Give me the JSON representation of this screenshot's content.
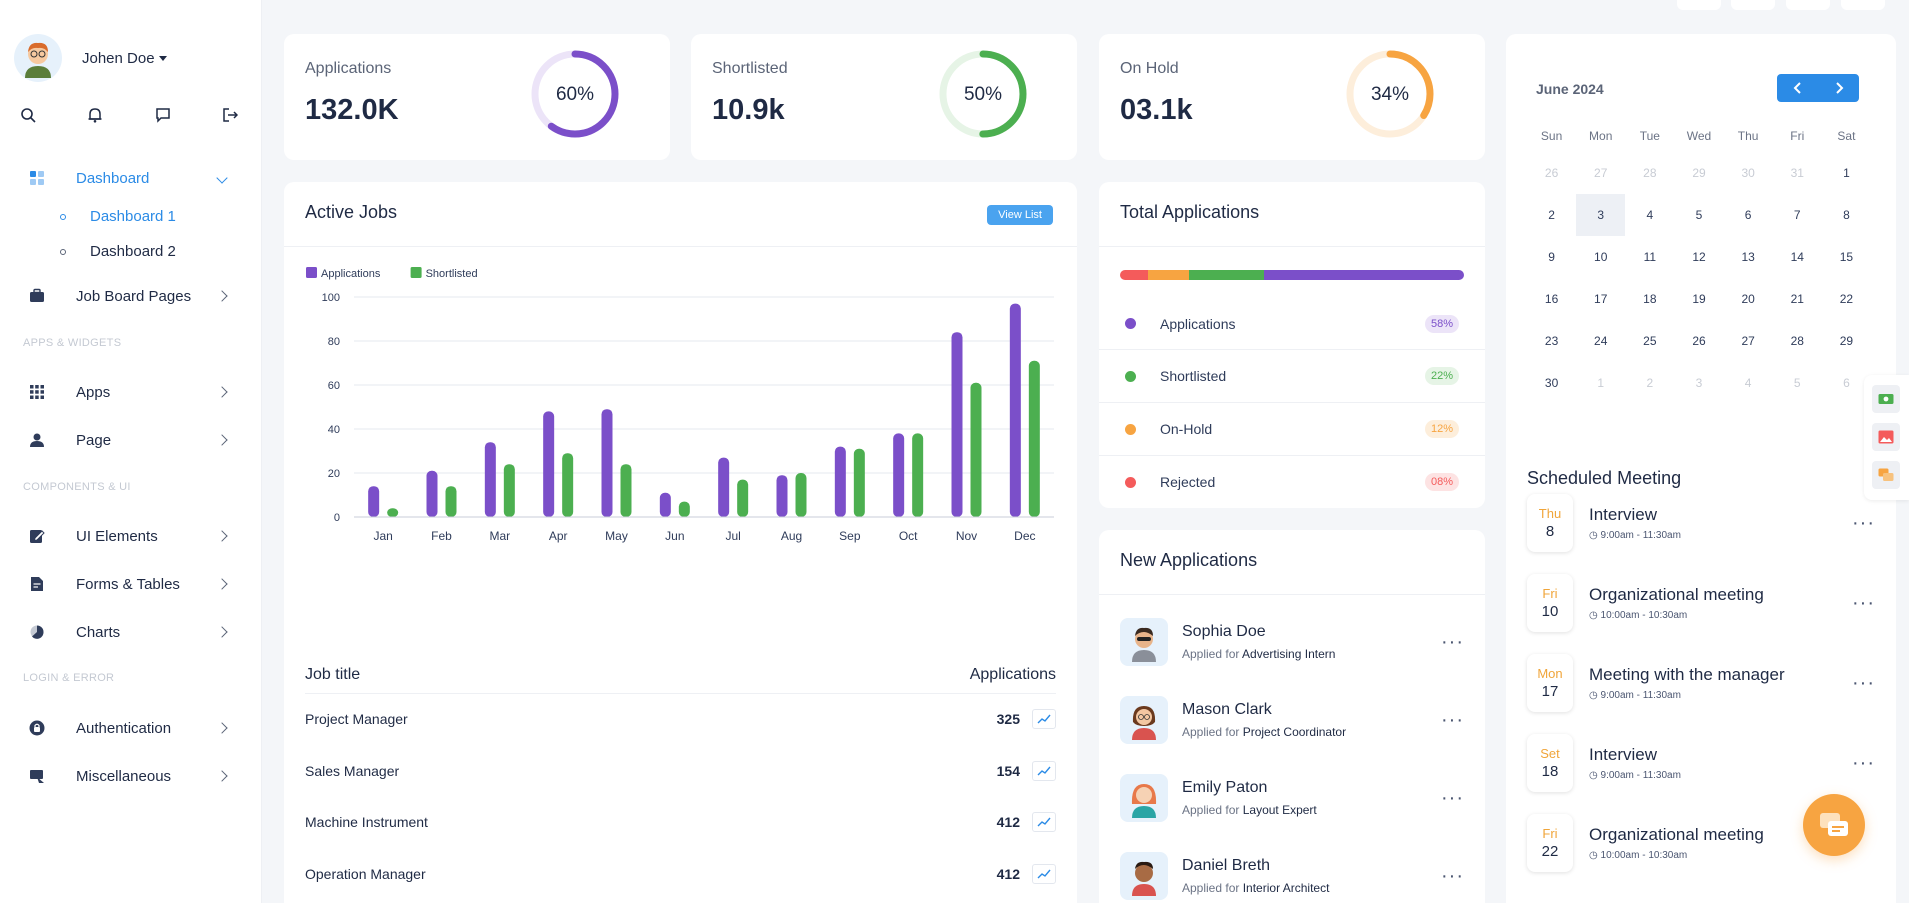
{
  "user": {
    "name": "Johen Doe"
  },
  "nav": {
    "dashboard": "Dashboard",
    "dashboard_sub": [
      "Dashboard 1",
      "Dashboard 2"
    ],
    "job_board": "Job Board Pages",
    "section_apps": "APPS & WIDGETS",
    "apps": "Apps",
    "page": "Page",
    "section_components": "COMPONENTS & UI",
    "ui_elements": "UI Elements",
    "forms_tables": "Forms & Tables",
    "charts": "Charts",
    "section_login": "LOGIN & ERROR",
    "authentication": "Authentication",
    "miscellaneous": "Miscellaneous"
  },
  "stats": [
    {
      "title": "Applications",
      "value": "132.0K",
      "percent": 60,
      "percent_label": "60%",
      "color": "#7b4fc9",
      "track": "#ece4f8"
    },
    {
      "title": "Shortlisted",
      "value": "10.9k",
      "percent": 50,
      "percent_label": "50%",
      "color": "#4caf50",
      "track": "#e6f4e6"
    },
    {
      "title": "On Hold",
      "value": "03.1k",
      "percent": 34,
      "percent_label": "34%",
      "color": "#f7a441",
      "track": "#fdeedb"
    }
  ],
  "active_jobs": {
    "title": "Active Jobs",
    "view_list": "View List",
    "table_header": {
      "job": "Job title",
      "applications": "Applications"
    },
    "rows": [
      {
        "job": "Project Manager",
        "count": "325"
      },
      {
        "job": "Sales Manager",
        "count": "154"
      },
      {
        "job": "Machine Instrument",
        "count": "412"
      },
      {
        "job": "Operation Manager",
        "count": "412"
      }
    ]
  },
  "chart_data": {
    "type": "bar",
    "categories": [
      "Jan",
      "Feb",
      "Mar",
      "Apr",
      "May",
      "Jun",
      "Jul",
      "Aug",
      "Sep",
      "Oct",
      "Nov",
      "Dec"
    ],
    "series": [
      {
        "name": "Applications",
        "color": "#7b4fc9",
        "values": [
          14,
          21,
          34,
          48,
          49,
          11,
          27,
          19,
          32,
          38,
          84,
          97
        ]
      },
      {
        "name": "Shortlisted",
        "color": "#4caf50",
        "values": [
          4,
          14,
          24,
          29,
          24,
          7,
          17,
          20,
          31,
          38,
          61,
          71
        ]
      }
    ],
    "yticks": [
      "0",
      "20",
      "40",
      "60",
      "80",
      "100"
    ],
    "ylim": [
      0,
      100
    ],
    "grid": true,
    "legend": "top-left"
  },
  "total_applications": {
    "title": "Total Applications",
    "segments": [
      {
        "color": "#f45b5b",
        "share": 8
      },
      {
        "color": "#f7a441",
        "share": 12
      },
      {
        "color": "#4caf50",
        "share": 22
      },
      {
        "color": "#7b4fc9",
        "share": 58
      }
    ],
    "rows": [
      {
        "label": "Applications",
        "badge": "58%",
        "color": "#7b4fc9",
        "badge_bg": "#ece4f8",
        "badge_fg": "#7b4fc9"
      },
      {
        "label": "Shortlisted",
        "badge": "22%",
        "color": "#4caf50",
        "badge_bg": "#e6f4e6",
        "badge_fg": "#4caf50"
      },
      {
        "label": "On-Hold",
        "badge": "12%",
        "color": "#f7a441",
        "badge_bg": "#fdeedb",
        "badge_fg": "#f7a441"
      },
      {
        "label": "Rejected",
        "badge": "08%",
        "color": "#f45b5b",
        "badge_bg": "#fde3e3",
        "badge_fg": "#f45b5b"
      }
    ]
  },
  "new_applications": {
    "title": "New Applications",
    "applied_for": "Applied for",
    "items": [
      {
        "name": "Sophia Doe",
        "role": "Advertising Intern"
      },
      {
        "name": "Mason Clark",
        "role": "Project Coordinator"
      },
      {
        "name": "Emily Paton",
        "role": "Layout Expert"
      },
      {
        "name": "Daniel Breth",
        "role": "Interior Architect"
      }
    ]
  },
  "calendar": {
    "month": "June 2024",
    "weekdays": [
      "Sun",
      "Mon",
      "Tue",
      "Wed",
      "Thu",
      "Fri",
      "Sat"
    ],
    "days": [
      {
        "d": "26",
        "muted": true
      },
      {
        "d": "27",
        "muted": true
      },
      {
        "d": "28",
        "muted": true
      },
      {
        "d": "29",
        "muted": true
      },
      {
        "d": "30",
        "muted": true
      },
      {
        "d": "31",
        "muted": true
      },
      {
        "d": "1"
      },
      {
        "d": "2"
      },
      {
        "d": "3",
        "selected": true
      },
      {
        "d": "4"
      },
      {
        "d": "5"
      },
      {
        "d": "6"
      },
      {
        "d": "7"
      },
      {
        "d": "8"
      },
      {
        "d": "9"
      },
      {
        "d": "10"
      },
      {
        "d": "11"
      },
      {
        "d": "12"
      },
      {
        "d": "13"
      },
      {
        "d": "14"
      },
      {
        "d": "15"
      },
      {
        "d": "16"
      },
      {
        "d": "17"
      },
      {
        "d": "18"
      },
      {
        "d": "19"
      },
      {
        "d": "20"
      },
      {
        "d": "21"
      },
      {
        "d": "22"
      },
      {
        "d": "23"
      },
      {
        "d": "24"
      },
      {
        "d": "25"
      },
      {
        "d": "26"
      },
      {
        "d": "27"
      },
      {
        "d": "28"
      },
      {
        "d": "29"
      },
      {
        "d": "30"
      },
      {
        "d": "1",
        "muted": true
      },
      {
        "d": "2",
        "muted": true
      },
      {
        "d": "3",
        "muted": true
      },
      {
        "d": "4",
        "muted": true
      },
      {
        "d": "5",
        "muted": true
      },
      {
        "d": "6",
        "muted": true
      }
    ]
  },
  "meetings": {
    "title": "Scheduled Meeting",
    "items": [
      {
        "day": "Thu",
        "date": "8",
        "title": "Interview",
        "time": "9:00am - 11:30am"
      },
      {
        "day": "Fri",
        "date": "10",
        "title": "Organizational meeting",
        "time": "10:00am - 10:30am"
      },
      {
        "day": "Mon",
        "date": "17",
        "title": "Meeting with the manager",
        "time": "9:00am - 11:30am"
      },
      {
        "day": "Set",
        "date": "18",
        "title": "Interview",
        "time": "9:00am - 11:30am"
      },
      {
        "day": "Fri",
        "date": "22",
        "title": "Organizational meeting",
        "time": "10:00am - 10:30am"
      }
    ]
  }
}
